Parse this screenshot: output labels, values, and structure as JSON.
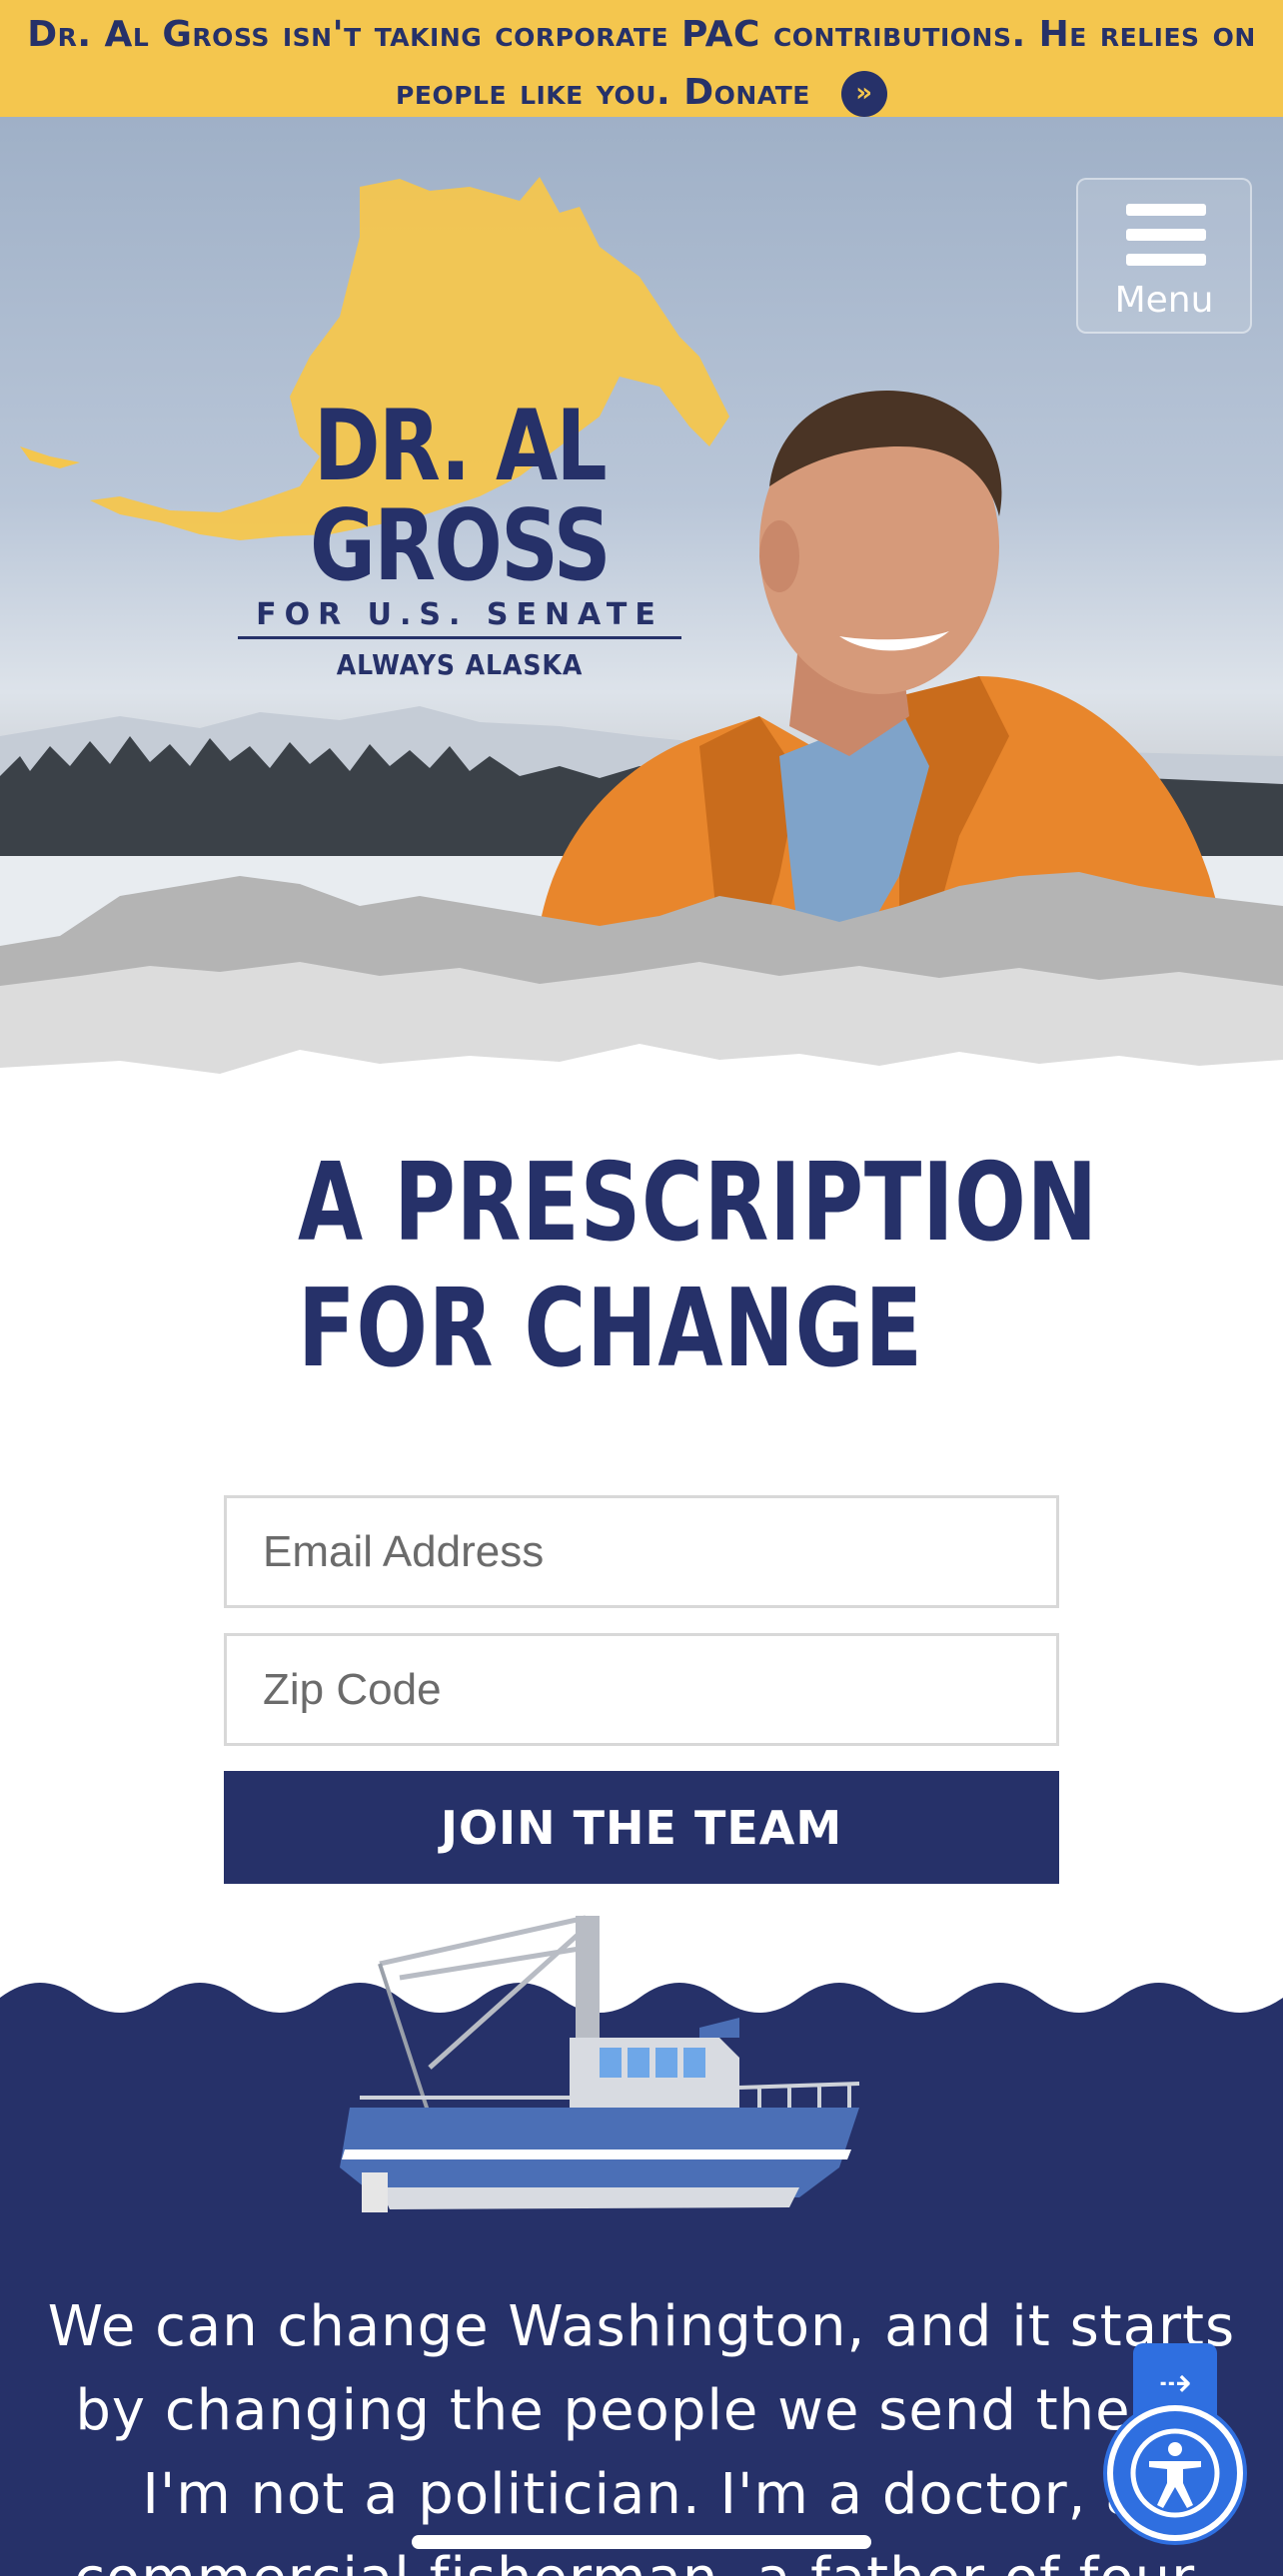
{
  "banner": {
    "text": "Dr. Al Gross isn't taking corporate PAC contributions. He relies on people like you.",
    "donate_label": "Donate",
    "arrow_glyph": "»"
  },
  "header": {
    "menu_label": "Menu",
    "menu_icon": "hamburger-icon"
  },
  "logo": {
    "name": "DR. AL GROSS",
    "subtitle": "FOR U.S. SENATE",
    "tagline": "ALWAYS ALASKA"
  },
  "signup": {
    "headline_line1": "A PRESCRIPTION",
    "headline_line2": "FOR CHANGE",
    "email_placeholder": "Email Address",
    "zip_placeholder": "Zip Code",
    "submit_label": "JOIN THE TEAM"
  },
  "story": {
    "text": "We can change Washington, and it starts by changing the people we send there. I'm not a politician. I'm a doctor, a commercial fisherman, a father of four."
  },
  "widgets": {
    "skip_icon": "arrow-right-icon",
    "accessibility_icon": "accessibility-icon"
  },
  "colors": {
    "navy": "#263169",
    "gold": "#f4c64e",
    "accessibility_blue": "#2f6fe0"
  }
}
